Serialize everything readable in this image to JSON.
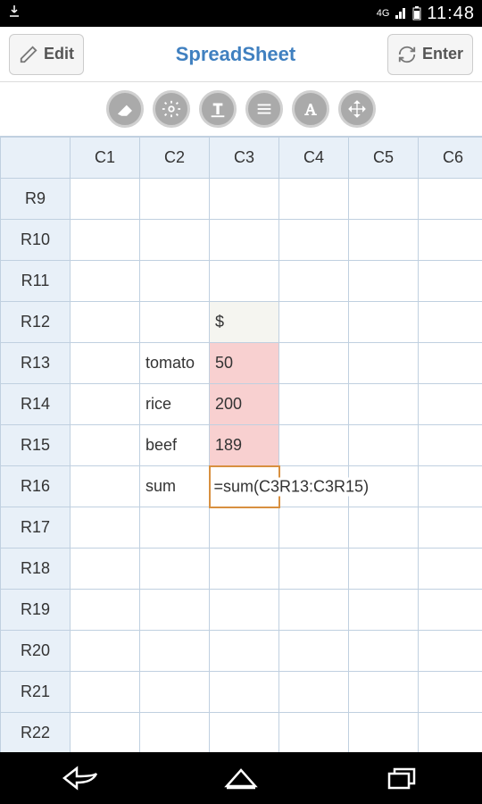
{
  "status": {
    "network": "4G",
    "time": "11:48"
  },
  "header": {
    "edit_label": "Edit",
    "title": "SpreadSheet",
    "enter_label": "Enter"
  },
  "toolbar": {
    "icons": [
      "eraser",
      "gear",
      "text",
      "lines",
      "font",
      "move"
    ]
  },
  "grid": {
    "columns": [
      "C1",
      "C2",
      "C3",
      "C4",
      "C5",
      "C6"
    ],
    "rows": [
      "R9",
      "R10",
      "R11",
      "R12",
      "R13",
      "R14",
      "R15",
      "R16",
      "R17",
      "R18",
      "R19",
      "R20",
      "R21",
      "R22"
    ],
    "cells": {
      "R12_C3": "$",
      "R13_C2": "tomato",
      "R13_C3": "50",
      "R14_C2": "rice",
      "R14_C3": "200",
      "R15_C2": "beef",
      "R15_C3": "189",
      "R16_C2": "sum",
      "R16_C3": "=sum(C3R13:C3R15)"
    },
    "highlighted_pink": [
      "R13_C3",
      "R14_C3",
      "R15_C3"
    ],
    "highlighted_light": [
      "R12_C3"
    ],
    "active_formula": "R16_C3"
  }
}
